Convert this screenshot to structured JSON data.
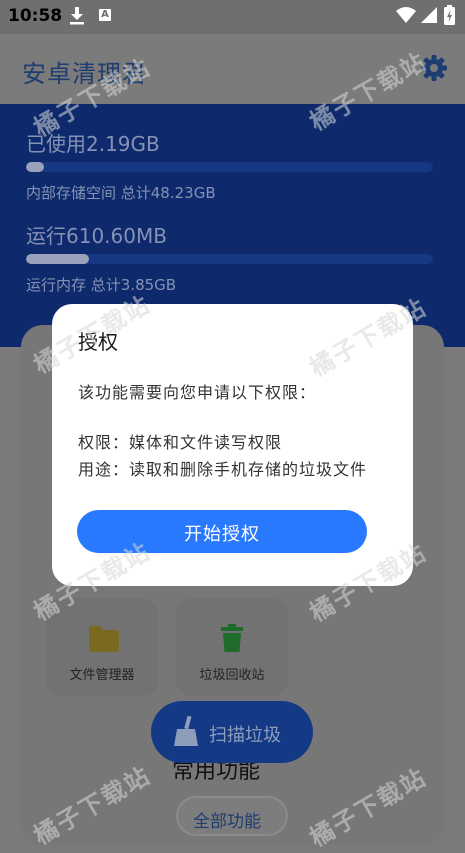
{
  "status_bar": {
    "time": "10:58",
    "a_glyph": "A"
  },
  "app_bar": {
    "title": "安卓清理君"
  },
  "storage": {
    "used_label": "已使用2.19GB",
    "used_fraction": 0.045,
    "used_sub": "内部存储空间 总计48.23GB",
    "ram_label": "运行610.60MB",
    "ram_fraction": 0.155,
    "ram_sub": "运行内存 总计3.85GB"
  },
  "dialog": {
    "title": "授权",
    "intro": "该功能需要向您申请以下权限：",
    "permission": "权限：媒体和文件读写权限",
    "purpose": "用途：读取和删除手机存储的垃圾文件",
    "button": "开始授权"
  },
  "tools": [
    {
      "label": "文件管理器",
      "icon": "folder-icon",
      "color": "#7a6a20"
    },
    {
      "label": "垃圾回收站",
      "icon": "trash-icon",
      "color": "#1e6b2a"
    }
  ],
  "scan_button": "扫描垃圾",
  "section_title": "常用功能",
  "all_functions": "全部功能",
  "watermark": "橘子下载站",
  "colors": {
    "accent": "#2979ff",
    "header_blue": "#0e2a6d"
  }
}
